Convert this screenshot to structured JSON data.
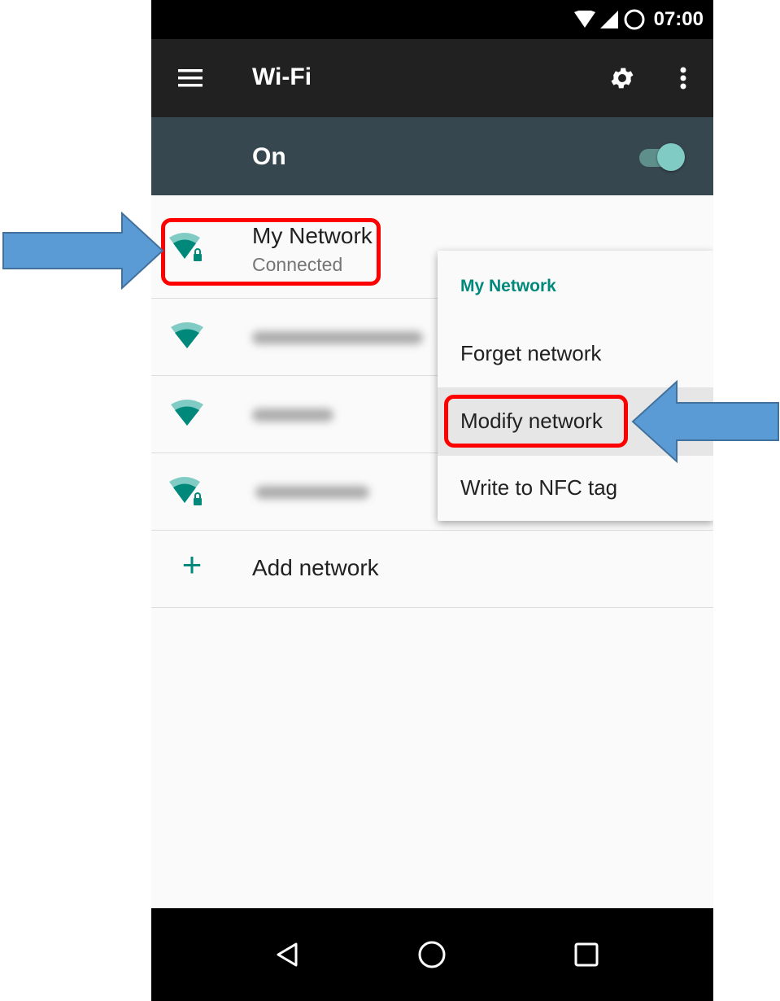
{
  "status_bar": {
    "time": "07:00"
  },
  "toolbar": {
    "title": "Wi-Fi",
    "menu_icon": "hamburger-menu-icon",
    "settings_icon": "gear-icon",
    "overflow_icon": "more-vert-icon"
  },
  "wifi_switch": {
    "label": "On",
    "enabled": true
  },
  "networks": [
    {
      "name": "My Network",
      "status": "Connected",
      "secured": true,
      "icon": "wifi-lock-icon"
    },
    {
      "name": "",
      "status": "",
      "secured": false,
      "icon": "wifi-icon"
    },
    {
      "name": "",
      "status": "",
      "secured": false,
      "icon": "wifi-icon"
    },
    {
      "name": "",
      "status": "",
      "secured": true,
      "icon": "wifi-lock-icon"
    }
  ],
  "add_network": {
    "label": "Add network",
    "icon": "plus-icon"
  },
  "context_menu": {
    "title": "My Network",
    "items": [
      {
        "label": "Forget network"
      },
      {
        "label": "Modify network",
        "highlighted": true
      },
      {
        "label": "Write to NFC tag"
      }
    ]
  },
  "nav_bar": {
    "back_icon": "back-triangle-icon",
    "home_icon": "home-circle-icon",
    "recents_icon": "recents-square-icon"
  },
  "colors": {
    "accent": "#00897b",
    "toolbar": "#212121",
    "switch_bar": "#37474f",
    "callout": "#ff0000",
    "arrow": "#5b9bd5"
  }
}
